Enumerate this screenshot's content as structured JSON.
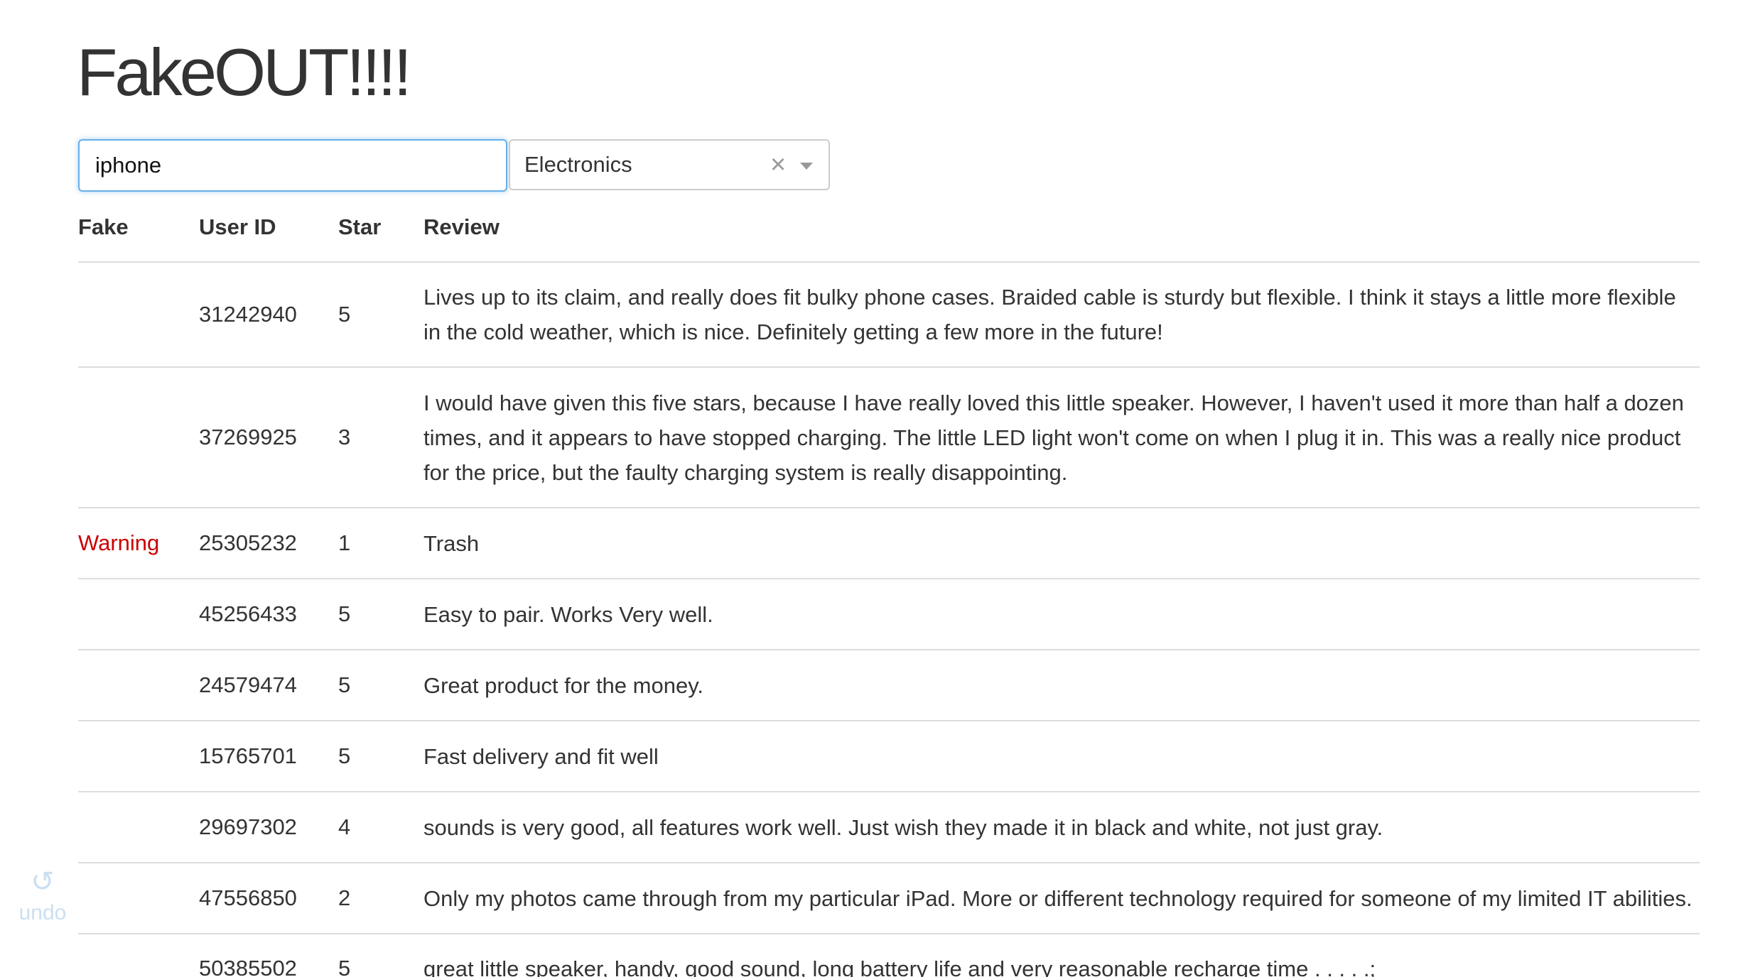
{
  "app": {
    "title": "FakeOUT!!!!"
  },
  "search": {
    "value": "iphone"
  },
  "category_select": {
    "selected": "Electronics",
    "clear_glyph": "×"
  },
  "table": {
    "headers": {
      "fake": "Fake",
      "user_id": "User ID",
      "star": "Star",
      "review": "Review"
    },
    "rows": [
      {
        "fake": "",
        "user_id": "31242940",
        "star": "5",
        "review": "Lives up to its claim, and really does fit bulky phone cases. Braided cable is sturdy but flexible. I think it stays a little more flexible in the cold weather, which is nice. Definitely getting a few more in the future!"
      },
      {
        "fake": "",
        "user_id": "37269925",
        "star": "3",
        "review": "I would have given this five stars, because I have really loved this little speaker. However, I haven't used it more than half a dozen times, and it appears to have stopped charging. The little LED light won't come on when I plug it in. This was a really nice product for the price, but the faulty charging system is really disappointing."
      },
      {
        "fake": "Warning",
        "user_id": "25305232",
        "star": "1",
        "review": "Trash"
      },
      {
        "fake": "",
        "user_id": "45256433",
        "star": "5",
        "review": "Easy to pair. Works Very well."
      },
      {
        "fake": "",
        "user_id": "24579474",
        "star": "5",
        "review": "Great product for the money."
      },
      {
        "fake": "",
        "user_id": "15765701",
        "star": "5",
        "review": "Fast delivery and fit well"
      },
      {
        "fake": "",
        "user_id": "29697302",
        "star": "4",
        "review": "sounds is very good, all features work well. Just wish they made it in black and white, not just gray."
      },
      {
        "fake": "",
        "user_id": "47556850",
        "star": "2",
        "review": "Only my photos came through from my particular iPad. More or different technology required for someone of my limited IT abilities."
      },
      {
        "fake": "",
        "user_id": "50385502",
        "star": "5",
        "review": "great little speaker, handy, good sound, long battery life and very reasonable recharge time . . . . .;"
      }
    ]
  },
  "undo": {
    "label": "undo",
    "icon": "undo-icon"
  },
  "colors": {
    "warning": "#cc0000",
    "focus_border": "#66afe9",
    "row_divider": "#dddddd",
    "undo": "#c9dff2"
  }
}
